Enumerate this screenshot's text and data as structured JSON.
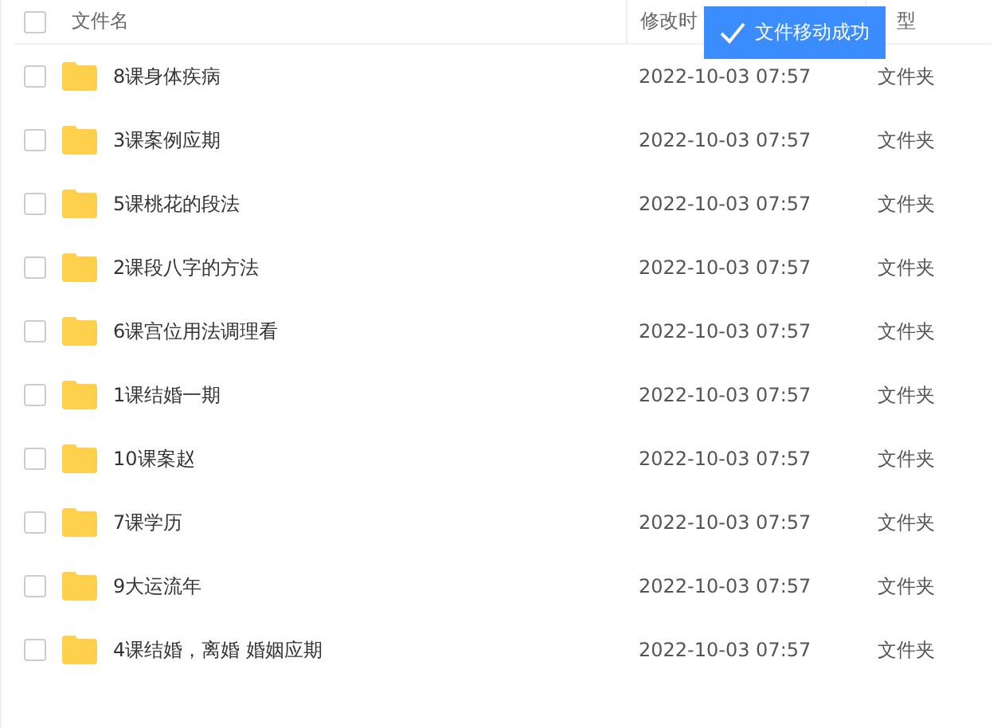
{
  "header": {
    "checked": false,
    "columns": [
      "文件名",
      "修改时",
      "型"
    ]
  },
  "toast": {
    "text": "文件移动成功"
  },
  "rows": [
    {
      "name": "8课身体疾病",
      "modified": "2022-10-03 07:57",
      "type": "文件夹",
      "checked": false
    },
    {
      "name": "3课案例应期",
      "modified": "2022-10-03 07:57",
      "type": "文件夹",
      "checked": false
    },
    {
      "name": "5课桃花的段法",
      "modified": "2022-10-03 07:57",
      "type": "文件夹",
      "checked": false
    },
    {
      "name": "2课段八字的方法",
      "modified": "2022-10-03 07:57",
      "type": "文件夹",
      "checked": false
    },
    {
      "name": "6课宫位用法调理看",
      "modified": "2022-10-03 07:57",
      "type": "文件夹",
      "checked": false
    },
    {
      "name": "1课结婚一期",
      "modified": "2022-10-03 07:57",
      "type": "文件夹",
      "checked": false
    },
    {
      "name": "10课案赵",
      "modified": "2022-10-03 07:57",
      "type": "文件夹",
      "checked": false
    },
    {
      "name": "7课学历",
      "modified": "2022-10-03 07:57",
      "type": "文件夹",
      "checked": false
    },
    {
      "name": "9大运流年",
      "modified": "2022-10-03 07:57",
      "type": "文件夹",
      "checked": false
    },
    {
      "name": "4课结婚，离婚  婚姻应期",
      "modified": "2022-10-03 07:57",
      "type": "文件夹",
      "checked": false
    }
  ]
}
